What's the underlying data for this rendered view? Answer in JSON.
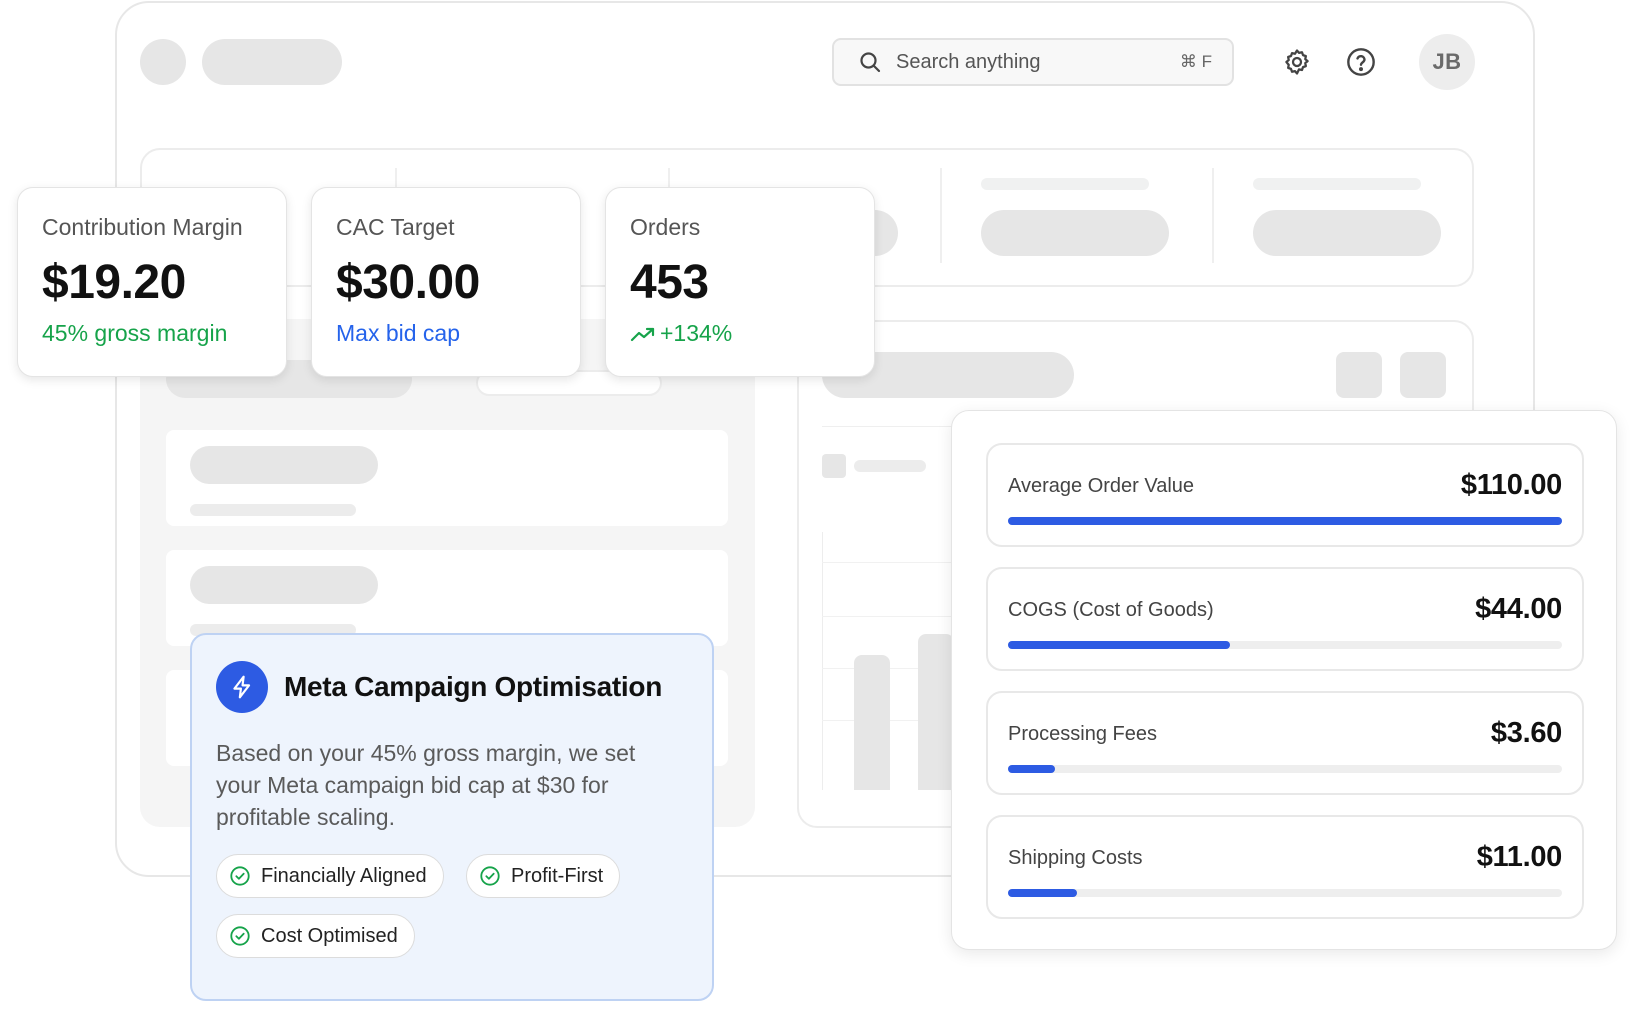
{
  "header": {
    "search_placeholder": "Search anything",
    "search_shortcut": "⌘ F",
    "settings_icon": "gear-icon",
    "help_icon": "question-circle-icon",
    "avatar_initials": "JB"
  },
  "kpis": [
    {
      "label": "Contribution Margin",
      "value": "$19.20",
      "sub": "45% gross margin",
      "sub_color": "#16a34a"
    },
    {
      "label": "CAC Target",
      "value": "$30.00",
      "sub": "Max bid cap",
      "sub_color": "#2563eb"
    },
    {
      "label": "Orders",
      "value": "453",
      "sub": "+134%",
      "sub_color": "#16a34a",
      "sub_icon": "trending-up-icon"
    }
  ],
  "breakdown": {
    "rows": [
      {
        "label": "Average Order Value",
        "value": "$110.00",
        "fill_percent": 100
      },
      {
        "label": "COGS (Cost of Goods)",
        "value": "$44.00",
        "fill_percent": 40
      },
      {
        "label": "Processing Fees",
        "value": "$3.60",
        "fill_percent": 8.5
      },
      {
        "label": "Shipping Costs",
        "value": "$11.00",
        "fill_percent": 12.5
      }
    ],
    "bar_color": "#2d5be3"
  },
  "meta_card": {
    "icon": "lightning-bolt-icon",
    "title": "Meta Campaign Optimisation",
    "description": "Based on your 45% gross margin, we set your Meta campaign bid cap at $30 for profitable scaling.",
    "tags": [
      "Financially Aligned",
      "Profit-First",
      "Cost Optimised"
    ],
    "tag_icon": "check-circle-icon",
    "accent": "#2d5be3"
  }
}
